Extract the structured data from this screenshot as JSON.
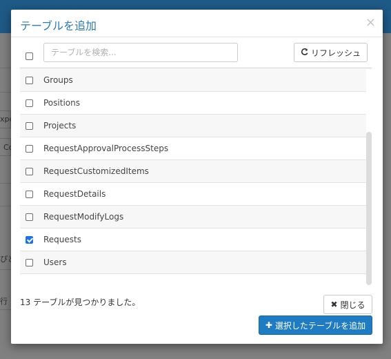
{
  "modal": {
    "title": "テーブルを追加",
    "close_glyph": "×"
  },
  "toolbar": {
    "search_placeholder": "テーブルを検索...",
    "refresh_label": "リフレッシュ",
    "refresh_icon": "refresh-icon",
    "select_all_checked": false
  },
  "tables": [
    {
      "name": "Groups",
      "checked": false
    },
    {
      "name": "Positions",
      "checked": false
    },
    {
      "name": "Projects",
      "checked": false
    },
    {
      "name": "RequestApprovalProcessSteps",
      "checked": false
    },
    {
      "name": "RequestCustomizedItems",
      "checked": false
    },
    {
      "name": "RequestDetails",
      "checked": false
    },
    {
      "name": "RequestModifyLogs",
      "checked": false
    },
    {
      "name": "Requests",
      "checked": true
    },
    {
      "name": "Users",
      "checked": false
    }
  ],
  "footer": {
    "found_text": "13 テーブルが見つかりました。",
    "close_label": "閉じる",
    "close_icon": "times-icon",
    "add_label": "選択したテーブルを追加",
    "add_icon": "plus-icon"
  },
  "background": {
    "fragments": [
      "xpe",
      "Co",
      "ぴと",
      "行"
    ]
  },
  "colors": {
    "accent": "#1f7cc2",
    "title": "#2a7ab6",
    "header_bg": "#1e5a86",
    "checkbox_checked": "#1a73e8"
  }
}
